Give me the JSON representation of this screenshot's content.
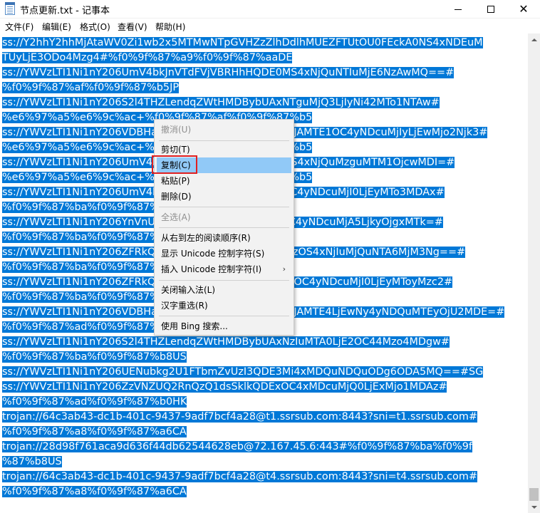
{
  "window": {
    "title": "节点更新.txt - 记事本",
    "minimize_icon": "minimize-icon",
    "maximize_icon": "maximize-icon",
    "close_label": "✕"
  },
  "menu": {
    "file": "文件(F)",
    "edit": "编辑(E)",
    "format": "格式(O)",
    "view": "查看(V)",
    "help": "帮助(H)"
  },
  "editor": {
    "selection_color": "#0078d7",
    "lines": [
      "ss://Y2hhY2hhMjAtaWV0Zi1wb2x5MTMwNTpGVHZzZlhDdlhMUEZFTUtOU0FEckA0NS4xNDEuM",
      "TUyLjE3ODo4Mzg4#%f0%9f%87%a9%f0%9f%87%aaDE",
      "ss://YWVzLTI1Ni1nY206UmV4bkJnVTdFVjVBRHhHQDE0MS4xNjQuNTIuMjE6NzAwMQ==#",
      "%f0%9f%87%af%f0%9f%87%b5JP",
      "ss://YWVzLTI1Ni1nY206S2l4THZLendqZWtHMDBybUAxNTguMjQ3LjIyNi42MTo1NTAw#",
      "%e6%97%a5%e6%9c%ac+%f0%9f%87%af%f0%9f%87%b5",
      "ss://YWVzLTI1Ni1nY206VDBHaFJ1YnVnUE1yTEVCcHFzMHJAMTE1OC4yNDcuMjIyLjEwMjo2Njk3#",
      "%e6%97%a5%e6%9c%ac+%f0%9f%87%af%f0%9f%87%b5",
      "ss://YWVzLTI1Ni1nY206UmV4bkJnVTdFVjVBRHhHQDE0MS4xNjQuMzguMTM1OjcwMDI=#",
      "%e6%97%a5%e6%9c%ac+%f0%9f%87%af%f0%9f%87%b5",
      "ss://YWVzLTI1Ni1nY206UmV4bkJnVTdFVjVBRHhHQDE1OC4yNDcuMjI0LjEyMTo3MDAx#",
      "%f0%9f%87%ba%f0%9f%87%b8US",
      "ss://YWVzLTI1Ni1nY206YnVnUE1yTEVCcHFzMHJAMTE1OC4yNDcuMjA5LjkyOjgxMTk=#",
      "%f0%9f%87%ba%f0%9f%87%b8US",
      "ss://YWVzLTI1Ni1nY206ZFRkQjZ1Yk9GeFVnNmQxMzQDEzOS4xNjIuMjQuNTA6MjM3Ng==#",
      "%f0%9f%87%ba%f0%9f%87%b8US",
      "ss://YWVzLTI1Ni1nY206ZFRkQjZ1Yk9GeFVnNmQxMQDE1OC4yNDcuMjI0LjEyMToyMzc2#",
      "%f0%9f%87%ba%f0%9f%87%b8US",
      "ss://YWVzLTI1Ni1nY206VDBHaFJ1YnVnUE1yTEVCcHFzMHJAMTE4LjEwNy4yNDQuMTEyOjU2MDE=#",
      "%f0%9f%87%ad%f0%9f%87%b0HK",
      "ss://YWVzLTI1Ni1nY206S2l4THZLendqZWtHMDBybUAxNzIuMTA0LjE2OC44Mzo4MDgw#",
      "%f0%9f%87%ba%f0%9f%87%b8US",
      "ss://YWVzLTI1Ni1nY206UENubkg2U1FTbmZvUzI3QDE3Mi4xMDQuNDQuODg6ODA5MQ==#SG",
      "ss://YWVzLTI1Ni1nY206ZzVNZUQ2RnQzQ1dsSklkQDExOC4xMDcuMjQ0LjExMjo1MDAz#",
      "%f0%9f%87%ad%f0%9f%87%b0HK",
      "trojan://64c3ab43-dc1b-401c-9437-9adf7bcf4a28@t1.ssrsub.com:8443?sni=t1.ssrsub.com#",
      "%f0%9f%87%a8%f0%9f%87%a6CA",
      "trojan://28d98f761aca9d636f44db62544628eb@72.167.45.6:443#%f0%9f%87%ba%f0%9f",
      "%87%b8US",
      "trojan://64c3ab43-dc1b-401c-9437-9adf7bcf4a28@t4.ssrsub.com:8443?sni=t4.ssrsub.com#",
      "%f0%9f%87%a8%f0%9f%87%a6CA"
    ]
  },
  "context_menu": {
    "undo": "撤消(U)",
    "cut": "剪切(T)",
    "copy": "复制(C)",
    "paste": "粘贴(P)",
    "delete": "删除(D)",
    "select_all": "全选(A)",
    "rtl": "从右到左的阅读顺序(R)",
    "show_unicode": "显示 Unicode 控制字符(S)",
    "insert_unicode": "插入 Unicode 控制字符(I)",
    "submenu_arrow": "›",
    "close_ime": "关闭输入法(L)",
    "reconvert": "汉字重选(R)",
    "bing_search": "使用 Bing 搜索...",
    "highlight_color": "#e02020",
    "hover_color": "#91c9f7"
  }
}
